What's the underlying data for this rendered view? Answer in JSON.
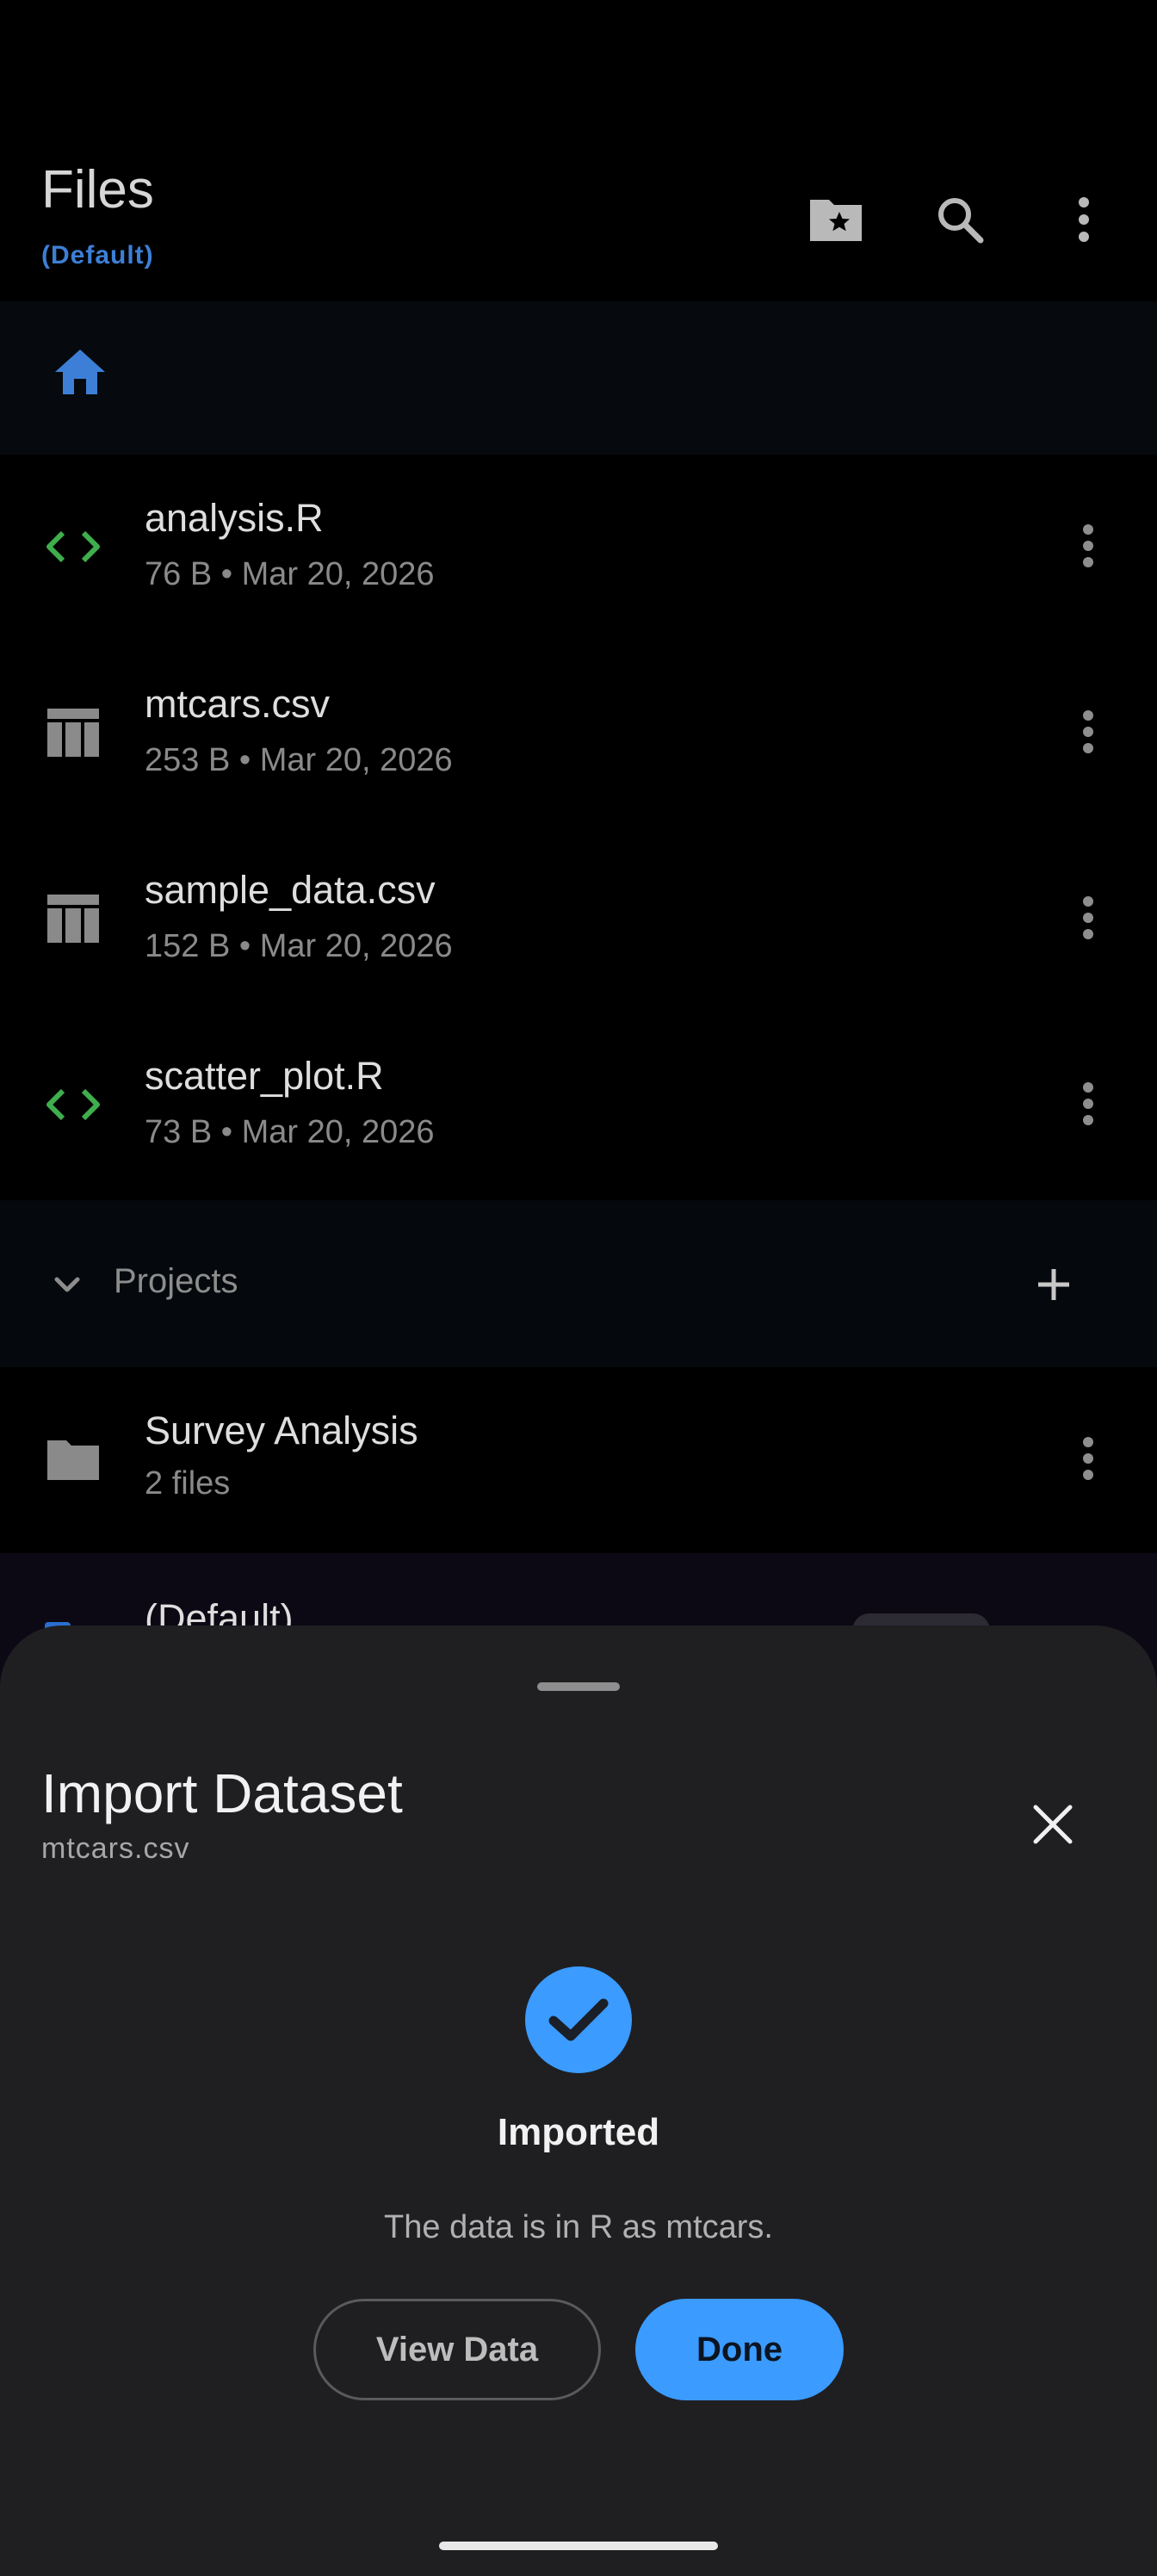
{
  "app_bar": {
    "title": "Files",
    "subtitle": "(Default)",
    "icons": [
      "folder-star-icon",
      "search-icon",
      "more-vert-icon"
    ]
  },
  "breadcrumb": {
    "icon": "home-icon",
    "accent": "#3d7fd6"
  },
  "files": [
    {
      "name": "analysis.R",
      "meta": "76 B • Mar 20, 2026",
      "icon": "code-icon"
    },
    {
      "name": "mtcars.csv",
      "meta": "253 B • Mar 20, 2026",
      "icon": "table-icon"
    },
    {
      "name": "sample_data.csv",
      "meta": "152 B • Mar 20, 2026",
      "icon": "table-icon"
    },
    {
      "name": "scatter_plot.R",
      "meta": "73 B • Mar 20, 2026",
      "icon": "code-icon"
    }
  ],
  "projects": {
    "label": "Projects",
    "items": [
      {
        "name": "Survey Analysis",
        "meta": "2 files",
        "icon": "folder-icon"
      },
      {
        "name": "(Default)",
        "icon": "folder-icon"
      }
    ]
  },
  "sheet": {
    "title": "Import Dataset",
    "file": "mtcars.csv",
    "status_title": "Imported",
    "status_message": "The data is in R as mtcars.",
    "view_button": "View Data",
    "done_button": "Done"
  },
  "colors": {
    "code_icon": "#3fae4d",
    "primary": "#3b9bff",
    "sheet_bg": "#1f1f22"
  }
}
